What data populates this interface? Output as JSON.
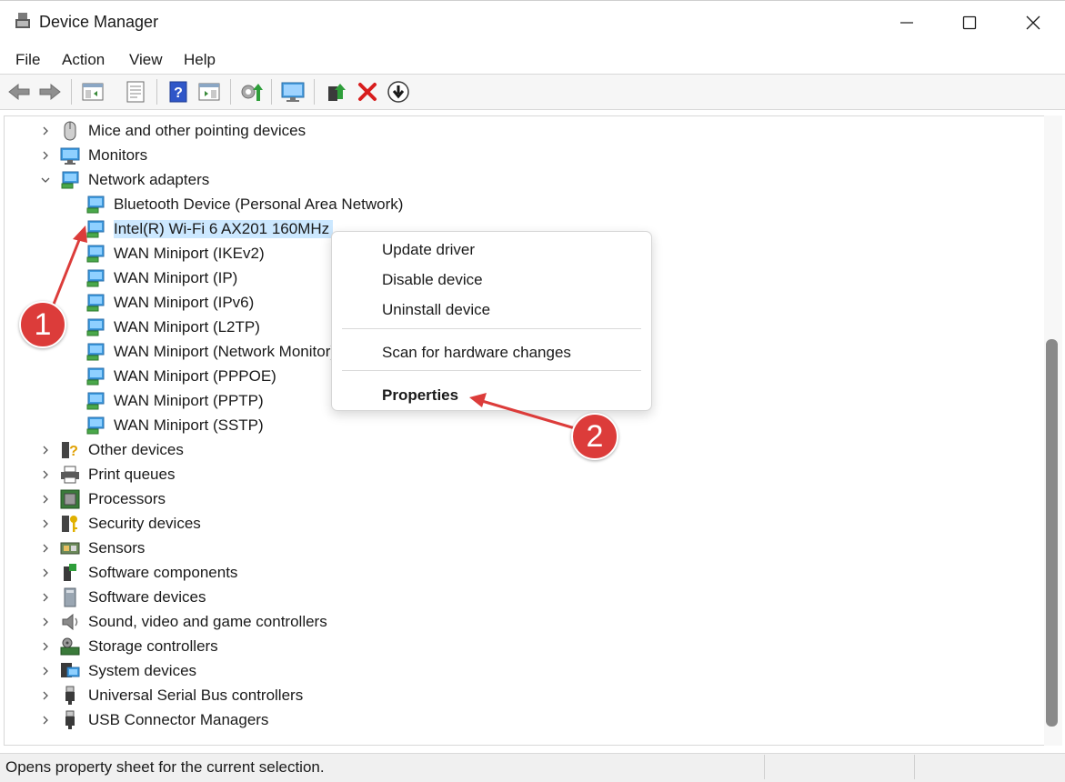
{
  "window": {
    "title": "Device Manager"
  },
  "menu": [
    "File",
    "Action",
    "View",
    "Help"
  ],
  "toolbar": [
    "back-icon",
    "forward-icon",
    "show-hide-tree-icon",
    "properties-icon",
    "help-icon",
    "action-pane-icon",
    "update-driver-icon",
    "monitor-scan-icon",
    "enable-device-icon",
    "uninstall-icon",
    "download-icon"
  ],
  "tree": {
    "categories_top": [
      {
        "label": "Mice and other pointing devices",
        "icon": "mouse-icon"
      },
      {
        "label": "Monitors",
        "icon": "monitor-icon"
      },
      {
        "label": "Network adapters",
        "icon": "network-adapter-icon",
        "expanded": true
      }
    ],
    "network_children": [
      "Bluetooth Device (Personal Area Network)",
      "Intel(R) Wi-Fi 6 AX201 160MHz",
      "WAN Miniport (IKEv2)",
      "WAN Miniport (IP)",
      "WAN Miniport (IPv6)",
      "WAN Miniport (L2TP)",
      "WAN Miniport (Network Monitor)",
      "WAN Miniport (PPPOE)",
      "WAN Miniport (PPTP)",
      "WAN Miniport (SSTP)"
    ],
    "selected_child": "Intel(R) Wi-Fi 6 AX201 160MHz",
    "categories_bottom": [
      {
        "label": "Other devices",
        "icon": "other-devices-icon"
      },
      {
        "label": "Print queues",
        "icon": "printer-icon"
      },
      {
        "label": "Processors",
        "icon": "processor-icon"
      },
      {
        "label": "Security devices",
        "icon": "security-key-icon"
      },
      {
        "label": "Sensors",
        "icon": "sensor-icon"
      },
      {
        "label": "Software components",
        "icon": "software-component-icon"
      },
      {
        "label": "Software devices",
        "icon": "software-device-icon"
      },
      {
        "label": "Sound, video and game controllers",
        "icon": "speaker-icon"
      },
      {
        "label": "Storage controllers",
        "icon": "storage-icon"
      },
      {
        "label": "System devices",
        "icon": "system-device-icon"
      },
      {
        "label": "Universal Serial Bus controllers",
        "icon": "usb-icon"
      },
      {
        "label": "USB Connector Managers",
        "icon": "usb-icon"
      }
    ]
  },
  "context_menu": {
    "items": [
      "Update driver",
      "Disable device",
      "Uninstall device",
      "Scan for hardware changes",
      "Properties"
    ]
  },
  "status": {
    "text": "Opens property sheet for the current selection."
  },
  "annotations": {
    "step1": "1",
    "step2": "2",
    "color": "#dc3c3a"
  }
}
